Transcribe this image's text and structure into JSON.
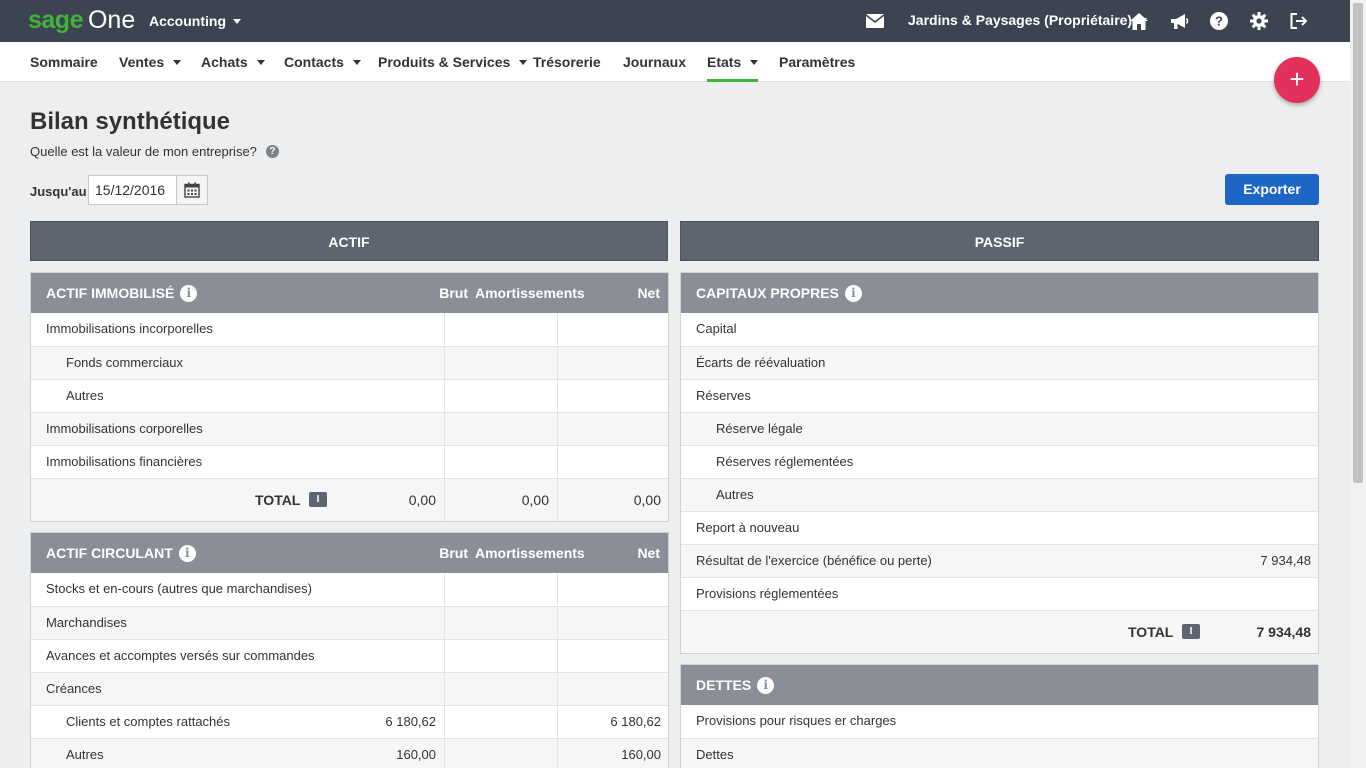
{
  "topbar": {
    "brand_sage": "sage",
    "brand_one": "One",
    "app_name": "Accounting",
    "company": "Jardins & Paysages (Propriétaire)"
  },
  "nav": {
    "items": [
      {
        "label": "Sommaire"
      },
      {
        "label": "Ventes"
      },
      {
        "label": "Achats"
      },
      {
        "label": "Contacts"
      },
      {
        "label": "Produits & Services"
      },
      {
        "label": "Trésorerie"
      },
      {
        "label": "Journaux"
      },
      {
        "label": "Etats"
      },
      {
        "label": "Paramètres"
      }
    ],
    "active": "Etats"
  },
  "fab": {
    "label": "+"
  },
  "page": {
    "title": "Bilan synthétique",
    "subtitle": "Quelle est la valeur de mon entreprise?",
    "help": "?",
    "date_label": "Jusqu'au",
    "date_value": "15/12/2016",
    "export_label": "Exporter"
  },
  "columns": {
    "left": "ACTIF",
    "right": "PASSIF"
  },
  "actif_immobilise": {
    "title": "ACTIF IMMOBILISÉ",
    "info": "i",
    "headers": {
      "brut": "Brut",
      "amort": "Amortissements",
      "net": "Net"
    },
    "rows": [
      {
        "label": "Immobilisations incorporelles",
        "brut": "",
        "amort": "",
        "net": ""
      },
      {
        "label": "Fonds commerciaux",
        "brut": "",
        "amort": "",
        "net": ""
      },
      {
        "label": "Autres",
        "brut": "",
        "amort": "",
        "net": ""
      },
      {
        "label": "Immobilisations corporelles",
        "brut": "",
        "amort": "",
        "net": ""
      },
      {
        "label": "Immobilisations financières",
        "brut": "",
        "amort": "",
        "net": ""
      }
    ],
    "total": {
      "label": "TOTAL",
      "badge": "I",
      "brut": "0,00",
      "amort": "0,00",
      "net": "0,00"
    }
  },
  "actif_circulant": {
    "title": "ACTIF CIRCULANT",
    "info": "i",
    "headers": {
      "brut": "Brut",
      "amort": "Amortissements",
      "net": "Net"
    },
    "rows": [
      {
        "label": "Stocks et en-cours (autres que marchandises)",
        "brut": "",
        "amort": "",
        "net": ""
      },
      {
        "label": "Marchandises",
        "brut": "",
        "amort": "",
        "net": ""
      },
      {
        "label": "Avances et accomptes versés sur commandes",
        "brut": "",
        "amort": "",
        "net": ""
      },
      {
        "label": "Créances",
        "brut": "",
        "amort": "",
        "net": ""
      },
      {
        "label": "Clients et comptes rattachés",
        "brut": "6 180,62",
        "amort": "",
        "net": "6 180,62"
      },
      {
        "label": "Autres",
        "brut": "160,00",
        "amort": "",
        "net": "160,00"
      }
    ]
  },
  "capitaux_propres": {
    "title": "CAPITAUX PROPRES",
    "info": "i",
    "rows": [
      {
        "label": "Capital",
        "value": ""
      },
      {
        "label": "Écarts de réévaluation",
        "value": ""
      },
      {
        "label": "Réserves",
        "value": ""
      },
      {
        "label": "Réserve légale",
        "value": ""
      },
      {
        "label": "Réserves réglementées",
        "value": ""
      },
      {
        "label": "Autres",
        "value": ""
      },
      {
        "label": "Report à nouveau",
        "value": ""
      },
      {
        "label": "Résultat de l'exercice (bénéfice ou perte)",
        "value": "7 934,48"
      },
      {
        "label": "Provisions réglementées",
        "value": ""
      }
    ],
    "total": {
      "label": "TOTAL",
      "badge": "I",
      "value": "7 934,48"
    }
  },
  "dettes": {
    "title": "DETTES",
    "info": "i",
    "rows": [
      {
        "label": "Provisions pour risques er charges",
        "value": ""
      },
      {
        "label": "Dettes",
        "value": ""
      }
    ]
  }
}
